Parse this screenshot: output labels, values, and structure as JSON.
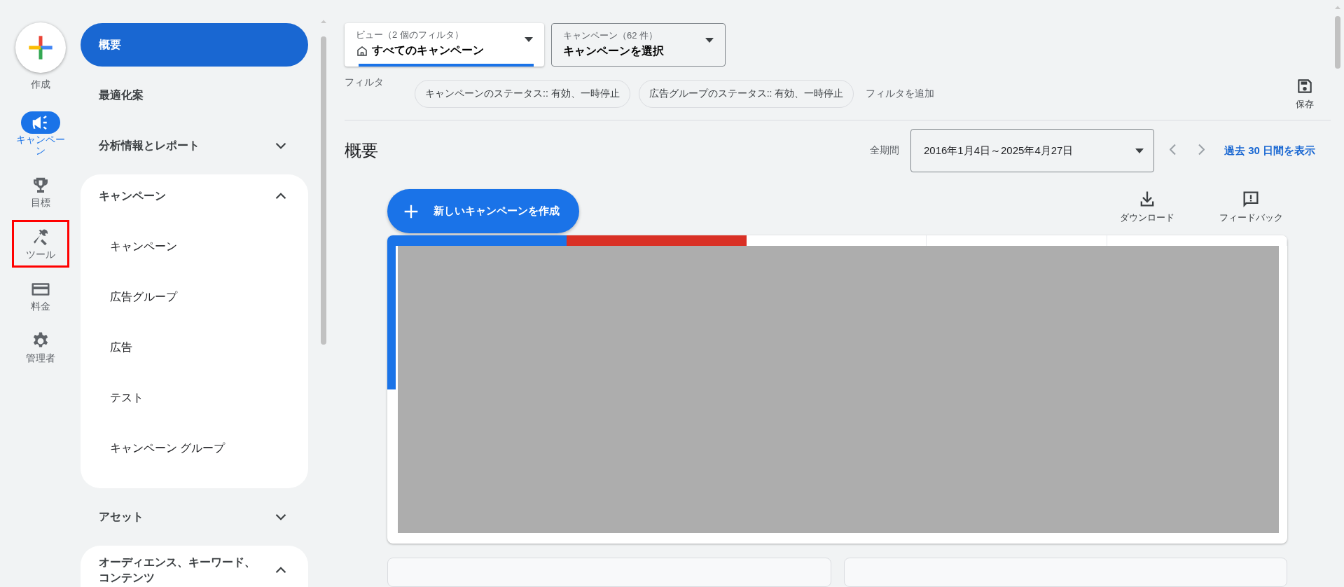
{
  "rail": {
    "create": {
      "label": "作成"
    },
    "items": [
      {
        "label": "キャンペーン",
        "selected": true,
        "highlighted": false
      },
      {
        "label": "目標",
        "selected": false,
        "highlighted": false
      },
      {
        "label": "ツール",
        "selected": false,
        "highlighted": true
      },
      {
        "label": "料金",
        "selected": false,
        "highlighted": false
      },
      {
        "label": "管理者",
        "selected": false,
        "highlighted": false
      }
    ]
  },
  "nav": {
    "items": [
      {
        "label": "概要",
        "selected": true
      },
      {
        "label": "最適化案",
        "selected": false
      },
      {
        "label": "分析情報とレポート",
        "selected": false,
        "expanded": false
      },
      {
        "label": "キャンペーン",
        "selected": false,
        "expanded": true,
        "children": [
          {
            "label": "キャンペーン",
            "selected": false
          },
          {
            "label": "広告グループ",
            "selected": false
          },
          {
            "label": "広告",
            "selected": false
          },
          {
            "label": "テスト",
            "selected": false
          },
          {
            "label": "キャンペーン グループ",
            "selected": false
          }
        ]
      },
      {
        "label": "アセット",
        "selected": false,
        "expanded": false
      },
      {
        "label": "オーディエンス、キーワード、コンテンツ",
        "selected": false,
        "expanded": true
      }
    ]
  },
  "view_select": {
    "label": "ビュー（2 個のフィルタ）",
    "value": "すべてのキャンペーン"
  },
  "campaign_select": {
    "label": "キャンペーン（62 件）",
    "value": "キャンペーンを選択"
  },
  "filters": {
    "label": "フィルタ",
    "chips": [
      "キャンペーンのステータス:: 有効、一時停止",
      "広告グループのステータス:: 有効、一時停止"
    ],
    "add": "フィルタを追加"
  },
  "save": "保存",
  "page_title": "概要",
  "date_range": {
    "label": "全期間",
    "value": "2016年1月4日～2025年4月27日",
    "link": "過去 30 日間を表示"
  },
  "create_button": "新しいキャンペーンを作成",
  "actions": [
    "ダウンロード",
    "フィードバック"
  ],
  "overview_card": {
    "metric_tiles": [
      {
        "selected": true,
        "color": "#1a73e8"
      },
      {
        "selected": true,
        "color": "#d93025"
      },
      {
        "selected": false
      },
      {
        "selected": false
      },
      {
        "selected": false
      }
    ]
  }
}
